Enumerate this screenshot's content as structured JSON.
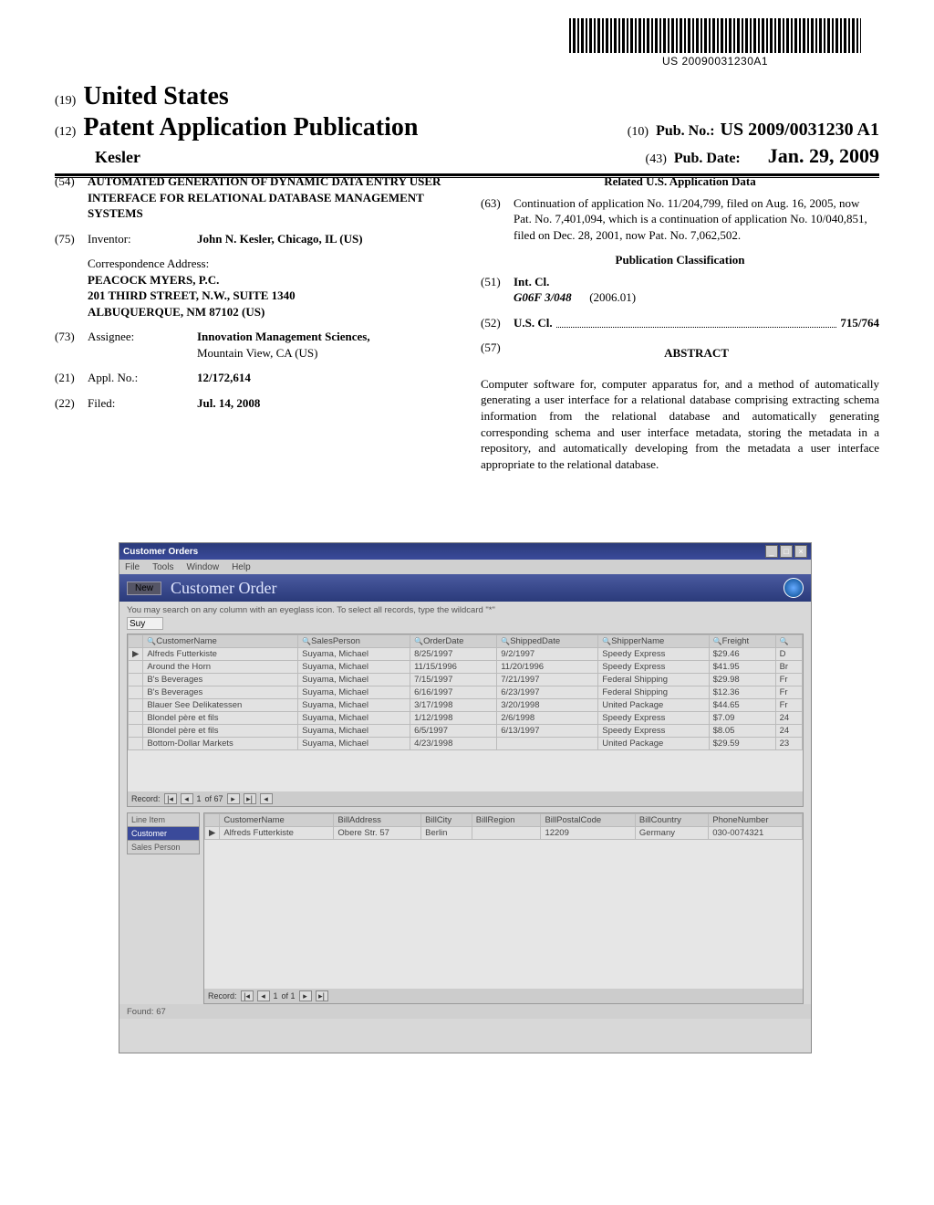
{
  "barcode_id": "US 20090031230A1",
  "header": {
    "code19": "(19)",
    "country": "United States",
    "code12": "(12)",
    "pub_kind": "Patent Application Publication",
    "author": "Kesler",
    "code10": "(10)",
    "pub_no_label": "Pub. No.:",
    "pub_no": "US 2009/0031230 A1",
    "code43": "(43)",
    "pub_date_label": "Pub. Date:",
    "pub_date": "Jan. 29, 2009"
  },
  "left_col": {
    "f54": {
      "code": "(54)",
      "title": "AUTOMATED GENERATION OF DYNAMIC DATA ENTRY USER INTERFACE FOR RELATIONAL DATABASE MANAGEMENT SYSTEMS"
    },
    "f75": {
      "code": "(75)",
      "label": "Inventor:",
      "value": "John N. Kesler, Chicago, IL (US)"
    },
    "correspondence": {
      "heading": "Correspondence Address:",
      "lines": [
        "PEACOCK MYERS, P.C.",
        "201 THIRD STREET, N.W., SUITE 1340",
        "ALBUQUERQUE, NM 87102 (US)"
      ]
    },
    "f73": {
      "code": "(73)",
      "label": "Assignee:",
      "name": "Innovation Management Sciences,",
      "loc": "Mountain View, CA (US)"
    },
    "f21": {
      "code": "(21)",
      "label": "Appl. No.:",
      "value": "12/172,614"
    },
    "f22": {
      "code": "(22)",
      "label": "Filed:",
      "value": "Jul. 14, 2008"
    }
  },
  "right_col": {
    "related_head": "Related U.S. Application Data",
    "f63": {
      "code": "(63)",
      "text": "Continuation of application No. 11/204,799, filed on Aug. 16, 2005, now Pat. No. 7,401,094, which is a continuation of application No. 10/040,851, filed on Dec. 28, 2001, now Pat. No. 7,062,502."
    },
    "pubclass_head": "Publication Classification",
    "f51": {
      "code": "(51)",
      "label": "Int. Cl.",
      "class": "G06F 3/048",
      "date": "(2006.01)"
    },
    "f52": {
      "code": "(52)",
      "label": "U.S. Cl.",
      "value": "715/764"
    },
    "f57": {
      "code": "(57)",
      "label": "ABSTRACT"
    },
    "abstract": "Computer software for, computer apparatus for, and a method of automatically generating a user interface for a relational database comprising extracting schema information from the relational database and automatically generating corresponding schema and user interface metadata, storing the metadata in a repository, and automatically developing from the metadata a user interface appropriate to the relational database."
  },
  "figure": {
    "window_title": "Customer Orders",
    "menus": [
      "File",
      "Tools",
      "Window",
      "Help"
    ],
    "toolbar": {
      "new_btn": "New",
      "title": "Customer Order"
    },
    "hint": "You may search on any column with an eyeglass icon. To select all records, type the wildcard \"*\"",
    "search_value": "Suy",
    "grid1": {
      "headers": [
        "",
        "CustomerName",
        "SalesPerson",
        "OrderDate",
        "ShippedDate",
        "ShipperName",
        "Freight",
        ""
      ],
      "header_icons": [
        "",
        "search-icon",
        "search-icon",
        "search-icon",
        "search-icon",
        "search-icon",
        "search-icon",
        "search-icon"
      ],
      "rows": [
        [
          "▶",
          "Alfreds Futterkiste",
          "Suyama, Michael",
          "8/25/1997",
          "9/2/1997",
          "Speedy Express",
          "$29.46",
          "D"
        ],
        [
          "",
          "Around the Horn",
          "Suyama, Michael",
          "11/15/1996",
          "11/20/1996",
          "Speedy Express",
          "$41.95",
          "Br"
        ],
        [
          "",
          "B's Beverages",
          "Suyama, Michael",
          "7/15/1997",
          "7/21/1997",
          "Federal Shipping",
          "$29.98",
          "Fr"
        ],
        [
          "",
          "B's Beverages",
          "Suyama, Michael",
          "6/16/1997",
          "6/23/1997",
          "Federal Shipping",
          "$12.36",
          "Fr"
        ],
        [
          "",
          "Blauer See Delikatessen",
          "Suyama, Michael",
          "3/17/1998",
          "3/20/1998",
          "United Package",
          "$44.65",
          "Fr"
        ],
        [
          "",
          "Blondel père et fils",
          "Suyama, Michael",
          "1/12/1998",
          "2/6/1998",
          "Speedy Express",
          "$7.09",
          "24"
        ],
        [
          "",
          "Blondel père et fils",
          "Suyama, Michael",
          "6/5/1997",
          "6/13/1997",
          "Speedy Express",
          "$8.05",
          "24"
        ],
        [
          "",
          "Bottom-Dollar Markets",
          "Suyama, Michael",
          "4/23/1998",
          "",
          "United Package",
          "$29.59",
          "23"
        ]
      ],
      "nav": {
        "label": "Record:",
        "pos": "1",
        "of": "of 67"
      }
    },
    "vtabs": [
      "Line Item",
      "Customer",
      "Sales Person"
    ],
    "active_vtab": 1,
    "grid2": {
      "headers": [
        "",
        "CustomerName",
        "BillAddress",
        "BillCity",
        "BillRegion",
        "BillPostalCode",
        "BillCountry",
        "PhoneNumber"
      ],
      "rows": [
        [
          "▶",
          "Alfreds Futterkiste",
          "Obere Str. 57",
          "Berlin",
          "",
          "12209",
          "Germany",
          "030-0074321"
        ]
      ],
      "nav": {
        "label": "Record:",
        "pos": "1",
        "of": "of 1"
      }
    },
    "status": "Found: 67"
  }
}
